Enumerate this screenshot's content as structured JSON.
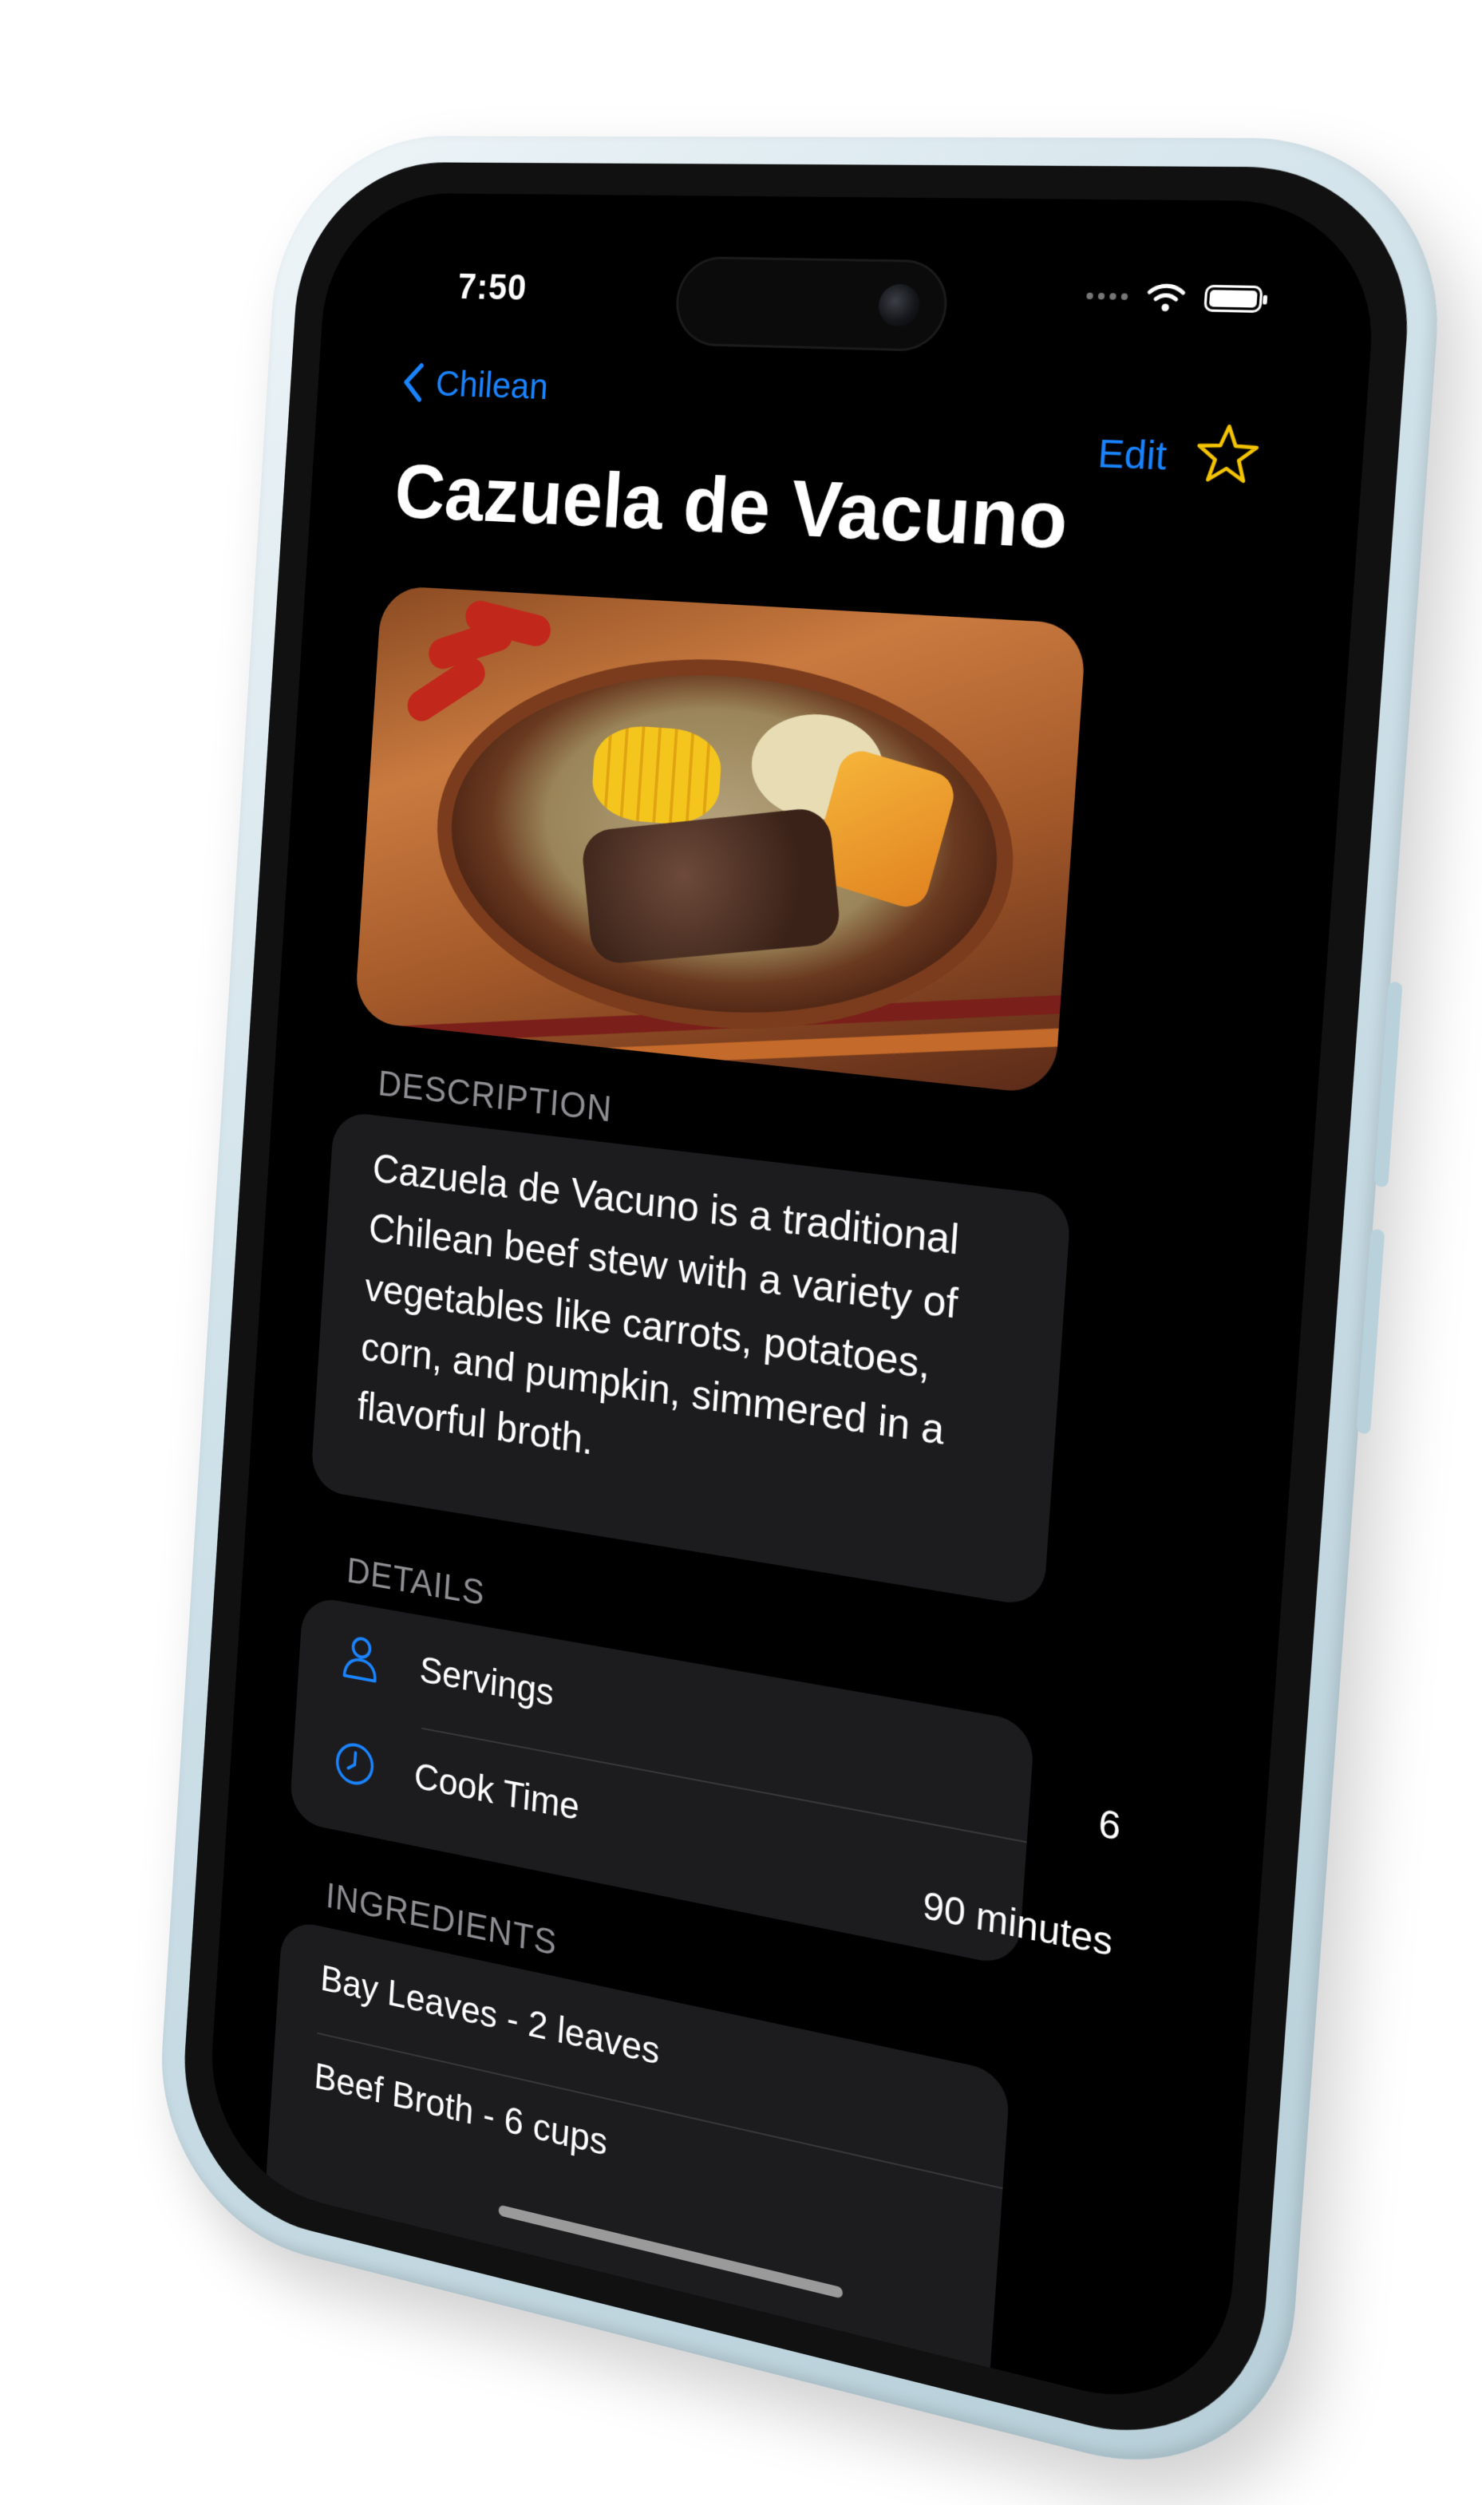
{
  "status_bar": {
    "time": "7:50"
  },
  "nav": {
    "back_label": "Chilean",
    "edit_label": "Edit"
  },
  "title": "Cazuela de Vacuno",
  "description": {
    "section_label": "DESCRIPTION",
    "text": "Cazuela de Vacuno is a traditional Chilean beef stew with a variety of vegetables like carrots, potatoes, corn, and pumpkin, simmered in a flavorful broth."
  },
  "details": {
    "section_label": "DETAILS",
    "servings_label": "Servings",
    "servings_value": "6",
    "cook_time_label": "Cook Time",
    "cook_time_value": "90 minutes"
  },
  "ingredients": {
    "section_label": "INGREDIENTS",
    "items": [
      "Bay Leaves - 2 leaves",
      "Beef Broth - 6 cups"
    ]
  },
  "icons": {
    "back": "chevron-left-icon",
    "favorite": "star-outline-icon",
    "servings": "person-icon",
    "cook_time": "clock-icon",
    "wifi": "wifi-icon",
    "battery": "battery-icon"
  },
  "colors": {
    "accent": "#1a84ff",
    "star": "#f5c400",
    "background": "#000000",
    "card": "#1c1c1e"
  }
}
